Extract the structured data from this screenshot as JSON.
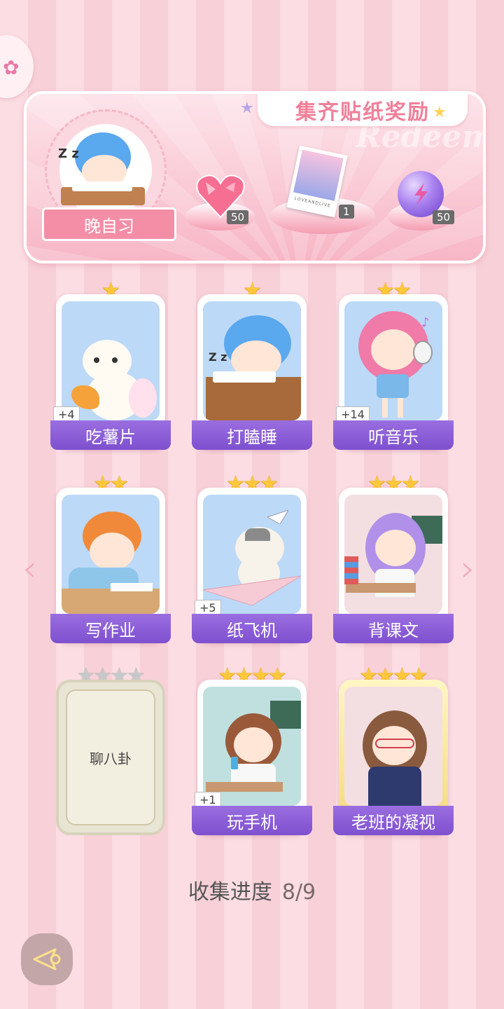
{
  "banner": {
    "title": "集齐贴纸奖励",
    "watermark": "Redeem",
    "avatar_label": "晚自习",
    "rewards": [
      {
        "icon": "heart-gem-icon",
        "qty": "50"
      },
      {
        "icon": "photo-card-icon",
        "qty": "1",
        "card_text": "LOVEANDLIVE"
      },
      {
        "icon": "energy-orb-icon",
        "qty": "50"
      }
    ]
  },
  "cards": [
    {
      "label": "吃薯片",
      "stars": 1,
      "max_stars": 1,
      "badge": "+4",
      "collected": true
    },
    {
      "label": "打瞌睡",
      "stars": 1,
      "max_stars": 1,
      "badge": "",
      "collected": true
    },
    {
      "label": "听音乐",
      "stars": 2,
      "max_stars": 2,
      "badge": "+14",
      "collected": true
    },
    {
      "label": "写作业",
      "stars": 2,
      "max_stars": 2,
      "badge": "",
      "collected": true
    },
    {
      "label": "纸飞机",
      "stars": 3,
      "max_stars": 3,
      "badge": "+5",
      "collected": true
    },
    {
      "label": "背课文",
      "stars": 3,
      "max_stars": 3,
      "badge": "",
      "collected": true
    },
    {
      "label": "聊八卦",
      "stars": 0,
      "max_stars": 4,
      "badge": "",
      "collected": false
    },
    {
      "label": "玩手机",
      "stars": 4,
      "max_stars": 4,
      "badge": "+1",
      "collected": true
    },
    {
      "label": "老班的凝视",
      "stars": 4,
      "max_stars": 4,
      "badge": "",
      "collected": true
    }
  ],
  "progress": {
    "label": "收集进度",
    "value": "8/9"
  },
  "colors": {
    "accent_pink": "#f48ea7",
    "plate_purple": "#8a5cd8",
    "star_gold": "#ffc83a"
  }
}
